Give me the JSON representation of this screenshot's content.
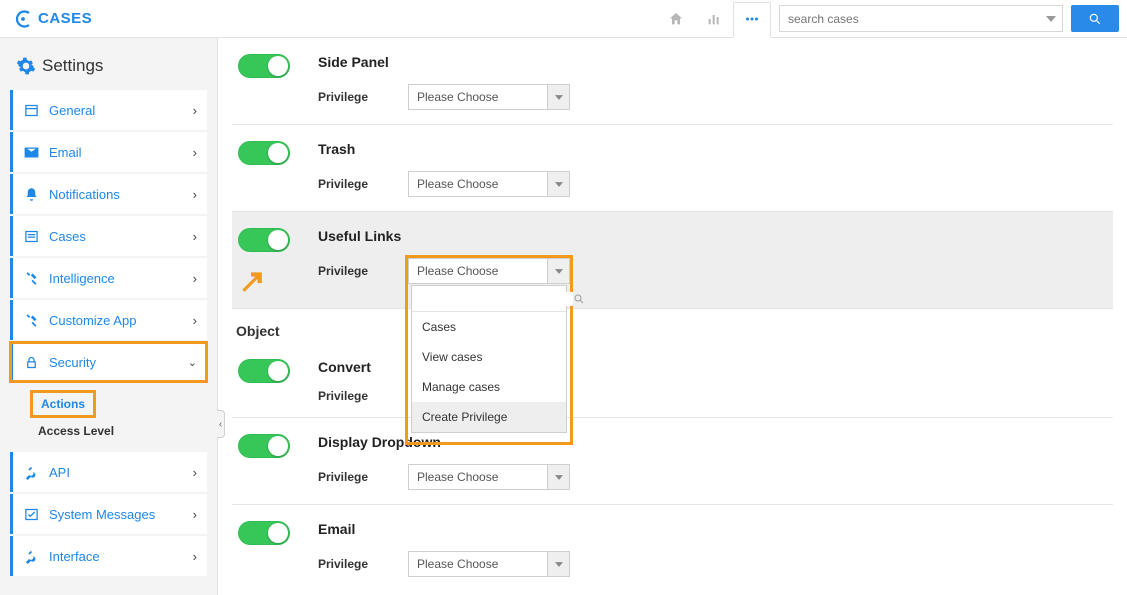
{
  "brand": {
    "title": "CASES"
  },
  "search": {
    "placeholder": "search cases"
  },
  "sidebar": {
    "title": "Settings",
    "items": [
      {
        "label": "General",
        "icon": "window"
      },
      {
        "label": "Email",
        "icon": "mail"
      },
      {
        "label": "Notifications",
        "icon": "bell"
      },
      {
        "label": "Cases",
        "icon": "list"
      },
      {
        "label": "Intelligence",
        "icon": "tools"
      },
      {
        "label": "Customize App",
        "icon": "tools"
      },
      {
        "label": "Security",
        "icon": "lock"
      },
      {
        "label": "API",
        "icon": "plug"
      },
      {
        "label": "System Messages",
        "icon": "check"
      },
      {
        "label": "Interface",
        "icon": "plug"
      }
    ],
    "sub": {
      "actions": "Actions",
      "access_level": "Access Level"
    }
  },
  "main": {
    "privilege_label": "Privilege",
    "choose_placeholder": "Please Choose",
    "rows": [
      {
        "title": "Side Panel"
      },
      {
        "title": "Trash"
      },
      {
        "title": "Useful Links"
      }
    ],
    "section_object": "Object",
    "rows2": [
      {
        "title": "Convert"
      },
      {
        "title": "Display Dropdown"
      },
      {
        "title": "Email"
      }
    ],
    "dropdown_options": [
      "Cases",
      "View cases",
      "Manage cases",
      "Create Privilege"
    ]
  }
}
